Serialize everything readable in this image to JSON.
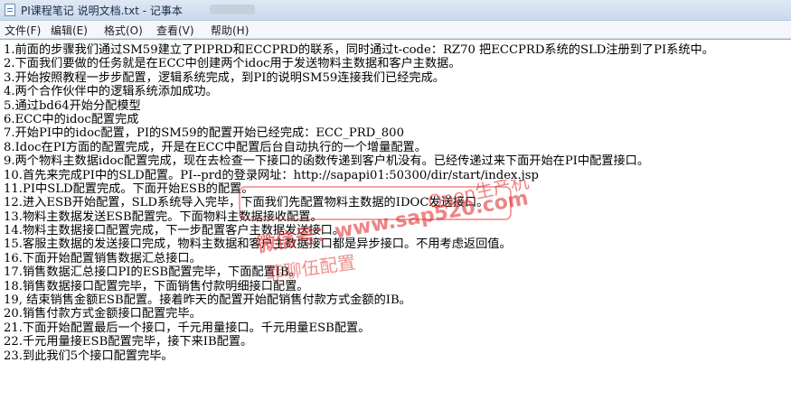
{
  "window": {
    "title": "PI课程笔记 说明文档.txt - 记事本",
    "icon": "notepad-icon"
  },
  "menu": {
    "items": [
      "文件(F)",
      "编辑(E)",
      "格式(O)",
      "查看(V)",
      "帮助(H)"
    ]
  },
  "document": {
    "lines": [
      "1.前面的步骤我们通过SM59建立了PIPRD和ECCPRD的联系，同时通过t-code：RZ70 把ECCPRD系统的SLD注册到了PI系统中。",
      "2.下面我们要做的任务就是在ECC中创建两个idoc用于发送物料主数据和客户主数据。",
      "3.开始按照教程一步步配置，逻辑系统完成，到PI的说明SM59连接我们已经完成。",
      "4.两个合作伙伴中的逻辑系统添加成功。",
      "5.通过bd64开始分配模型",
      "6.ECC中的idoc配置完成",
      "7.开始PI中的idoc配置，PI的SM59的配置开始已经完成：ECC_PRD_800",
      "8.Idoc在PI方面的配置完成，开是在ECC中配置后台自动执行的一个增量配置。",
      "9.两个物料主数据idoc配置完成，现在去检查一下接口的函数传递到客户机没有。已经传递过来下面开始在PI中配置接口。",
      "10.首先来完成PI中的SLD配置。PI--prd的登录网址：http://sapapi01:50300/dir/start/index.jsp",
      "11.PI中SLD配置完成。下面开始ESB的配置。",
      "12.进入ESB开始配置，SLD系统导入完毕，下面我们先配置物料主数据的IDOC发送接口。",
      "13.物料主数据发送ESB配置完。下面物料主数据接收配置。",
      "14.物料主数据接口配置完成，下一步配置客户主数据发送接口。",
      "15.客服主数据的发送接口完成，物料主数据和客户主数据接口都是异步接口。不用考虑返回值。",
      "16.下面开始配置销售数据汇总接口。",
      "17.销售数据汇总接口PI的ESB配置完毕，下面配置IB。",
      "18.销售数据接口配置完毕，下面销售付款明细接口配置。",
      "19, 结束销售金额ESB配置。接着昨天的配置开始配销售付款方式金额的IB。",
      "20.销售付款方式金额接口配置完毕。",
      "21.下面开始配置最后一个接口，千元用量接口。千元用量ESB配置。",
      "22.千元用量接ESB配置完毕，接下来IB配置。",
      "23.到此我们5个接口配置完毕。"
    ]
  },
  "watermark": {
    "line1": "Open生产机",
    "line2": "微信号：www.sap520.com",
    "line3": "菲聊伍配置",
    "color": "#e02020"
  }
}
